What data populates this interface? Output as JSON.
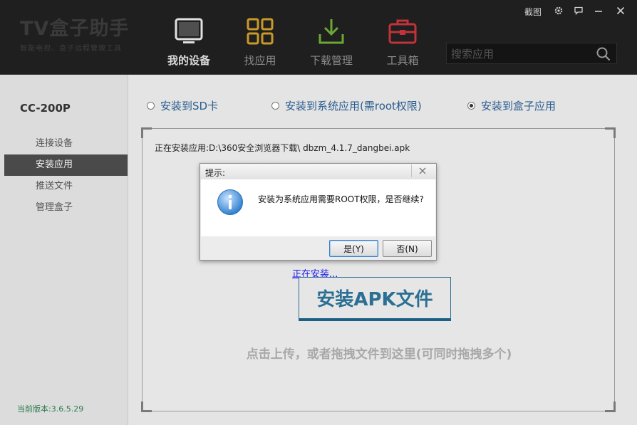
{
  "app": {
    "logo_title": "TV盒子助手",
    "logo_subtitle": "智能电视、盒子远程管理工具"
  },
  "nav": [
    {
      "label": "我的设备",
      "icon": "tv-icon",
      "active": true
    },
    {
      "label": "找应用",
      "icon": "grid-icon",
      "active": false
    },
    {
      "label": "下载管理",
      "icon": "download-icon",
      "active": false
    },
    {
      "label": "工具箱",
      "icon": "toolbox-icon",
      "active": false
    }
  ],
  "search": {
    "placeholder": "搜索应用"
  },
  "window_controls": {
    "screenshot_label": "截图"
  },
  "sidebar": {
    "device_name": "CC-200P",
    "items": [
      {
        "label": "连接设备",
        "active": false
      },
      {
        "label": "安装应用",
        "active": true
      },
      {
        "label": "推送文件",
        "active": false
      },
      {
        "label": "管理盒子",
        "active": false
      }
    ],
    "version": "当前版本:3.6.5.29"
  },
  "install_options": [
    {
      "label": "安装到SD卡",
      "selected": false
    },
    {
      "label": "安装到系统应用(需root权限)",
      "selected": false
    },
    {
      "label": "安装到盒子应用",
      "selected": true
    }
  ],
  "main": {
    "installing_path": "正在安装应用:D:\\360安全浏览器下载\\ dbzm_4.1.7_dangbei.apk",
    "installing_status": "正在安装...",
    "install_button": "安装APK文件",
    "drop_hint": "点击上传，或者拖拽文件到这里(可同时拖拽多个)"
  },
  "dialog": {
    "title": "提示:",
    "message": "安装为系统应用需要ROOT权限，是否继续?",
    "yes_label": "是(Y)",
    "no_label": "否(N)"
  },
  "colors": {
    "header_bg": "#1f1f1f",
    "sidebar_active_bg": "#4a4a4a",
    "accent_blue": "#2c6f93",
    "version_green": "#2e7d4f"
  }
}
